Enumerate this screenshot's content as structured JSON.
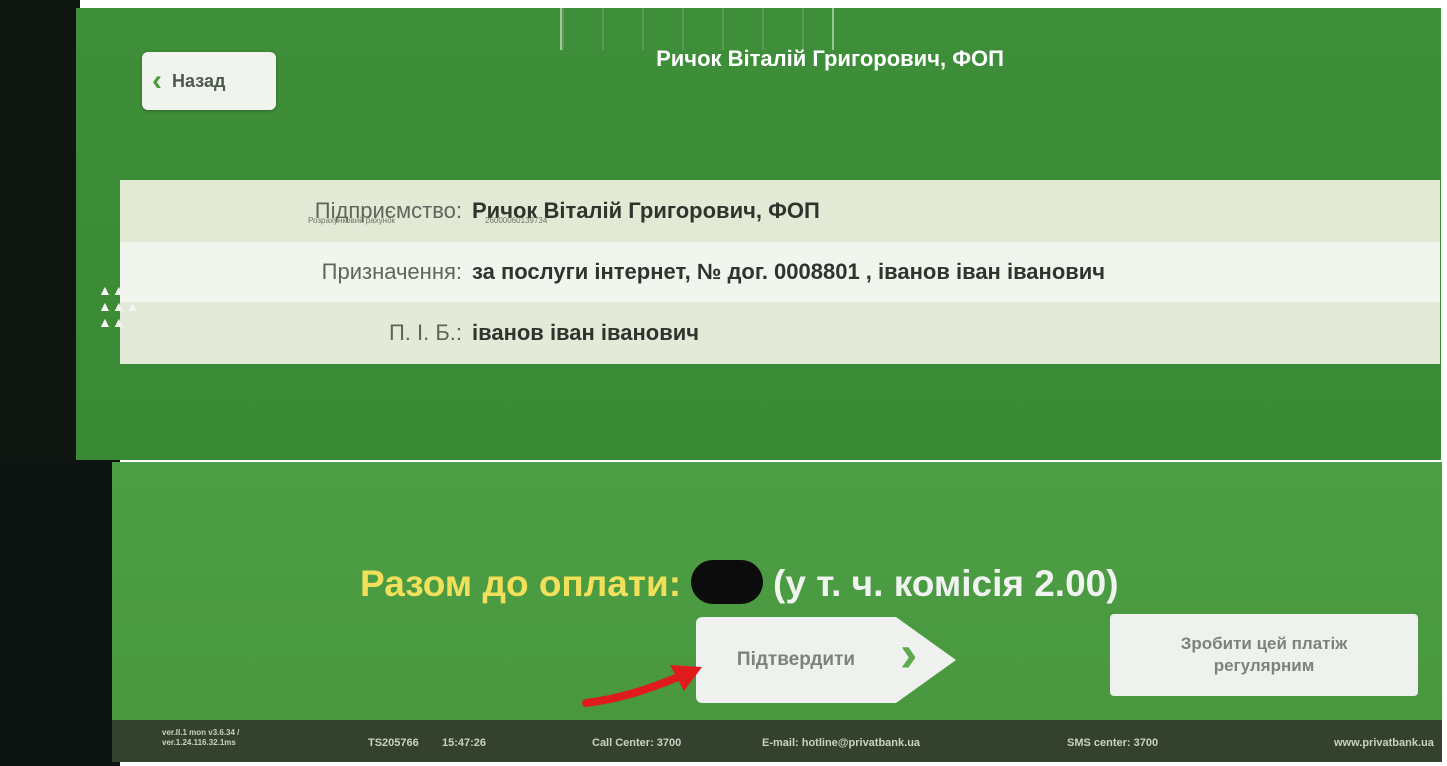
{
  "header": {
    "title": "Ричок Віталій Григорович, ФОП",
    "back_label": "Назад"
  },
  "details": [
    {
      "label": "Підприємство:",
      "value": "Ричок Віталій Григорович, ФОП",
      "sublabel": "Розрахунковий рахунок",
      "subvalue": "26000060139734"
    },
    {
      "label": "Призначення:",
      "value": "за послуги інтернет, № дог. 0008801 , іванов іван іванович"
    },
    {
      "label": "П. І. Б.:",
      "value": "іванов іван іванович"
    }
  ],
  "total": {
    "label": "Разом до оплати:",
    "commission": "(у т. ч. комісія 2.00)"
  },
  "buttons": {
    "confirm": "Підтвердити",
    "make_regular": "Зробити цей платіж регулярним"
  },
  "status_bar": {
    "version": "ver.II.1 mon v3.6.34 / ver.1.24.116.32.1ms",
    "terminal_id": "TS205766",
    "time": "15:47:26",
    "call_center": "Call Center: 3700",
    "email": "E-mail: hotline@privatbank.ua",
    "sms_center": "SMS center: 3700",
    "website": "www.privatbank.ua"
  },
  "colors": {
    "screen_green": "#3f8f3a",
    "total_label_yellow": "#f2e05a",
    "annotation_red": "#e01b1b"
  }
}
